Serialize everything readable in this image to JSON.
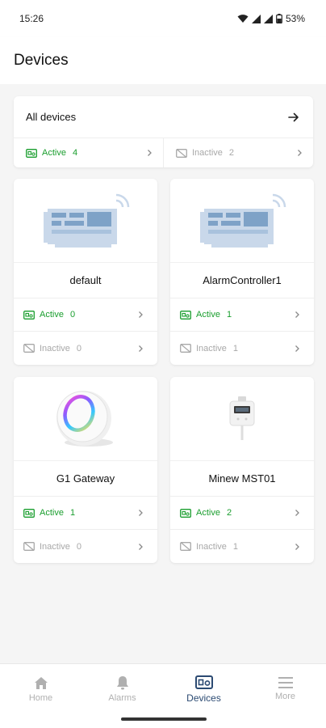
{
  "status_bar": {
    "time": "15:26",
    "battery": "53%"
  },
  "header": {
    "title": "Devices"
  },
  "all_devices": {
    "title": "All devices",
    "active": {
      "label": "Active",
      "count": "4"
    },
    "inactive": {
      "label": "Inactive",
      "count": "2"
    }
  },
  "devices": [
    {
      "name": "default",
      "active_label": "Active",
      "active_count": "0",
      "inactive_label": "Inactive",
      "inactive_count": "0"
    },
    {
      "name": "AlarmController1",
      "active_label": "Active",
      "active_count": "1",
      "inactive_label": "Inactive",
      "inactive_count": "1"
    },
    {
      "name": "G1 Gateway",
      "active_label": "Active",
      "active_count": "1",
      "inactive_label": "Inactive",
      "inactive_count": "0"
    },
    {
      "name": "Minew MST01",
      "active_label": "Active",
      "active_count": "2",
      "inactive_label": "Inactive",
      "inactive_count": "1"
    }
  ],
  "nav": {
    "items": [
      {
        "label": "Home",
        "icon": "home-icon"
      },
      {
        "label": "Alarms",
        "icon": "bell-icon"
      },
      {
        "label": "Devices",
        "icon": "devices-icon"
      },
      {
        "label": "More",
        "icon": "menu-icon"
      }
    ],
    "selected": "Devices"
  },
  "colors": {
    "active": "#1a9e2e",
    "inactive": "#a8a8a8",
    "nav_selected": "#2b4a72",
    "nav_default": "#b0b0b0"
  }
}
